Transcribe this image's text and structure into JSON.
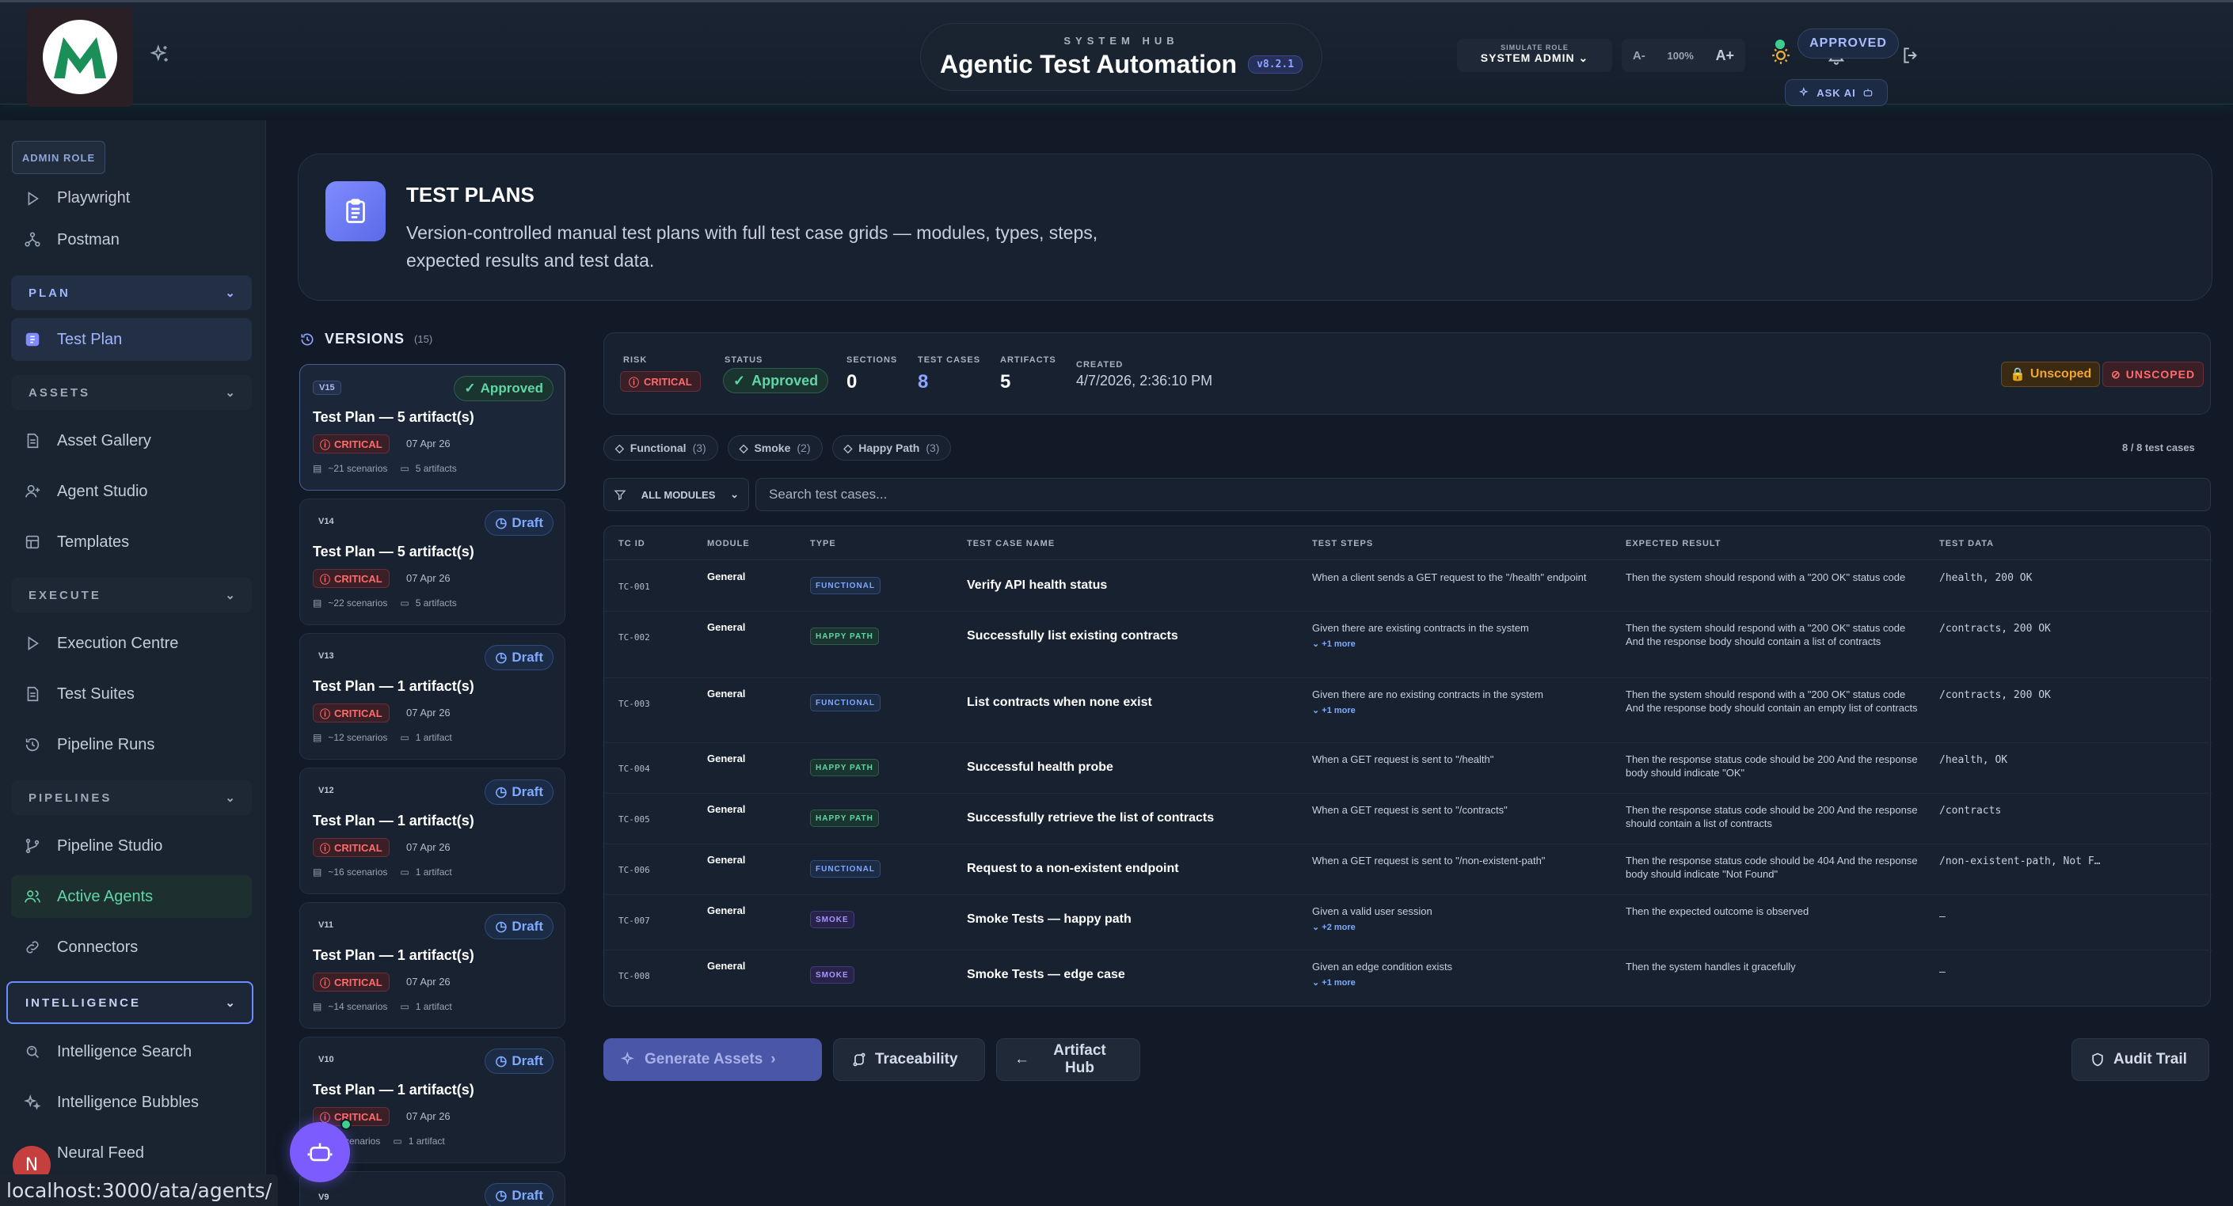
{
  "header": {
    "eyebrow": "SYSTEM HUB",
    "title": "Agentic Test Automation",
    "version": "v8.2.1",
    "role_label": "SIMULATE ROLE",
    "role_value": "SYSTEM ADMIN",
    "zoom_down": "A-",
    "zoom_pct": "100%",
    "zoom_up": "A+",
    "logo_letter": "M"
  },
  "sidebar": {
    "admin_badge": "ADMIN ROLE",
    "items": {
      "playwright": "Playwright",
      "postman": "Postman",
      "plan_section": "PLAN",
      "test_plan": "Test Plan",
      "assets_section": "ASSETS",
      "asset_gallery": "Asset Gallery",
      "agent_studio": "Agent Studio",
      "templates": "Templates",
      "execute_section": "EXECUTE",
      "execution_centre": "Execution Centre",
      "test_suites": "Test Suites",
      "pipeline_runs": "Pipeline Runs",
      "pipelines_section": "PIPELINES",
      "pipeline_studio": "Pipeline Studio",
      "active_agents": "Active Agents",
      "connectors": "Connectors",
      "intelligence_section": "INTELLIGENCE",
      "intelligence_search": "Intelligence Search",
      "intelligence_bubbles": "Intelligence Bubbles",
      "neural_feed": "Neural Feed"
    },
    "avatar_initial": "N"
  },
  "status_url": "localhost:3000/ata/agents/",
  "plan": {
    "title": "TEST PLANS",
    "description": "Version-controlled manual test plans with full test case grids — modules, types, steps, expected results and test data.",
    "status": "APPROVED",
    "ask_ai": "ASK AI"
  },
  "versions": {
    "title": "VERSIONS",
    "count": "(15)",
    "cards": [
      {
        "tag": "V15",
        "status": "Approved",
        "title": "Test Plan — 5 artifact(s)",
        "risk": "CRITICAL",
        "date": "07 Apr 26",
        "scenarios": "~21 scenarios",
        "artifacts": "5 artifacts"
      },
      {
        "tag": "V14",
        "status": "Draft",
        "title": "Test Plan — 5 artifact(s)",
        "risk": "CRITICAL",
        "date": "07 Apr 26",
        "scenarios": "~22 scenarios",
        "artifacts": "5 artifacts"
      },
      {
        "tag": "V13",
        "status": "Draft",
        "title": "Test Plan — 1 artifact(s)",
        "risk": "CRITICAL",
        "date": "07 Apr 26",
        "scenarios": "~12 scenarios",
        "artifacts": "1 artifact"
      },
      {
        "tag": "V12",
        "status": "Draft",
        "title": "Test Plan — 1 artifact(s)",
        "risk": "CRITICAL",
        "date": "07 Apr 26",
        "scenarios": "~16 scenarios",
        "artifacts": "1 artifact"
      },
      {
        "tag": "V11",
        "status": "Draft",
        "title": "Test Plan — 1 artifact(s)",
        "risk": "CRITICAL",
        "date": "07 Apr 26",
        "scenarios": "~14 scenarios",
        "artifacts": "1 artifact"
      },
      {
        "tag": "V10",
        "status": "Draft",
        "title": "Test Plan — 1 artifact(s)",
        "risk": "CRITICAL",
        "date": "07 Apr 26",
        "scenarios": "scenarios",
        "artifacts": "1 artifact"
      },
      {
        "tag": "V9",
        "status": "Draft"
      }
    ]
  },
  "summary": {
    "risk_label": "RISK",
    "risk_value": "CRITICAL",
    "status_label": "STATUS",
    "status_value": "Approved",
    "sections_label": "SECTIONS",
    "sections_value": "0",
    "testcases_label": "TEST CASES",
    "testcases_value": "8",
    "artifacts_label": "ARTIFACTS",
    "artifacts_value": "5",
    "created_label": "CREATED",
    "created_value": "4/7/2026, 2:36:10 PM",
    "scope_warning": "Unscoped",
    "scope_badge": "UNSCOPED"
  },
  "chips": [
    {
      "label": "Functional",
      "count": "(3)"
    },
    {
      "label": "Smoke",
      "count": "(2)"
    },
    {
      "label": "Happy Path",
      "count": "(3)"
    }
  ],
  "tc_count": "8 / 8 test cases",
  "filter": {
    "module": "ALL MODULES",
    "search_placeholder": "Search test cases..."
  },
  "table": {
    "headers": [
      "TC ID",
      "MODULE",
      "TYPE",
      "TEST CASE NAME",
      "TEST STEPS",
      "EXPECTED RESULT",
      "TEST DATA"
    ],
    "rows": [
      {
        "id": "TC-001",
        "module": "General",
        "type": "FUNCTIONAL",
        "name": "Verify API health status",
        "steps": "When a client sends a GET request to the \"/health\" endpoint",
        "more": "",
        "expected": "Then the system should respond with a \"200 OK\" status code",
        "data": "/health, 200 OK"
      },
      {
        "id": "TC-002",
        "module": "General",
        "type": "HAPPY PATH",
        "name": "Successfully list existing contracts",
        "steps": "Given there are existing contracts in the system",
        "more": "+1 more",
        "expected": "Then the system should respond with a \"200 OK\" status code And the response body should contain a list of contracts",
        "data": "/contracts, 200 OK"
      },
      {
        "id": "TC-003",
        "module": "General",
        "type": "FUNCTIONAL",
        "name": "List contracts when none exist",
        "steps": "Given there are no existing contracts in the system",
        "more": "+1 more",
        "expected": "Then the system should respond with a \"200 OK\" status code And the response body should contain an empty list of contracts",
        "data": "/contracts, 200 OK"
      },
      {
        "id": "TC-004",
        "module": "General",
        "type": "HAPPY PATH",
        "name": "Successful health probe",
        "steps": "When a GET request is sent to \"/health\"",
        "more": "",
        "expected": "Then the response status code should be 200 And the response body should indicate \"OK\"",
        "data": "/health, OK"
      },
      {
        "id": "TC-005",
        "module": "General",
        "type": "HAPPY PATH",
        "name": "Successfully retrieve the list of contracts",
        "steps": "When a GET request is sent to \"/contracts\"",
        "more": "",
        "expected": "Then the response status code should be 200 And the response should contain a list of contracts",
        "data": "/contracts"
      },
      {
        "id": "TC-006",
        "module": "General",
        "type": "FUNCTIONAL",
        "name": "Request to a non-existent endpoint",
        "steps": "When a GET request is sent to \"/non-existent-path\"",
        "more": "",
        "expected": "Then the response status code should be 404 And the response body should indicate \"Not Found\"",
        "data": "/non-existent-path, Not F…"
      },
      {
        "id": "TC-007",
        "module": "General",
        "type": "SMOKE",
        "name": "Smoke Tests — happy path",
        "steps": "Given a valid user session",
        "more": "+2 more",
        "expected": "Then the expected outcome is observed",
        "data": "—"
      },
      {
        "id": "TC-008",
        "module": "General",
        "type": "SMOKE",
        "name": "Smoke Tests — edge case",
        "steps": "Given an edge condition exists",
        "more": "+1 more",
        "expected": "Then the system handles it gracefully",
        "data": "—"
      }
    ]
  },
  "actions": {
    "generate": "Generate Assets",
    "traceability": "Traceability",
    "artifact_hub": "Artifact Hub",
    "audit_trail": "Audit Trail"
  }
}
